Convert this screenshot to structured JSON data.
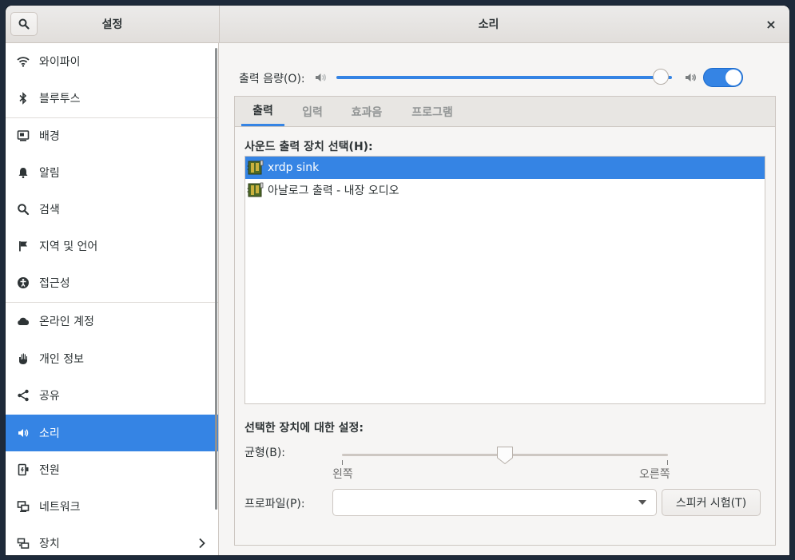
{
  "header": {
    "sidebar_title": "설정",
    "main_title": "소리",
    "close_glyph": "×"
  },
  "sidebar": {
    "items": [
      {
        "label": "와이파이",
        "icon": "wifi-icon"
      },
      {
        "label": "블루투스",
        "icon": "bluetooth-icon"
      },
      {
        "label": "배경",
        "icon": "background-icon"
      },
      {
        "label": "알림",
        "icon": "bell-icon"
      },
      {
        "label": "검색",
        "icon": "search-icon"
      },
      {
        "label": "지역 및 언어",
        "icon": "flag-icon"
      },
      {
        "label": "접근성",
        "icon": "accessibility-icon"
      },
      {
        "label": "온라인 계정",
        "icon": "cloud-icon"
      },
      {
        "label": "개인 정보",
        "icon": "hand-icon"
      },
      {
        "label": "공유",
        "icon": "share-icon"
      },
      {
        "label": "소리",
        "icon": "speaker-icon"
      },
      {
        "label": "전원",
        "icon": "power-icon"
      },
      {
        "label": "네트워크",
        "icon": "network-icon"
      },
      {
        "label": "장치",
        "icon": "devices-icon"
      }
    ],
    "active": "소리"
  },
  "volume": {
    "label": "출력 음량(O):",
    "level": 0.99,
    "enabled": true
  },
  "tabs": [
    "출력",
    "입력",
    "효과음",
    "프로그램"
  ],
  "active_tab": "출력",
  "output": {
    "device_section_label": "사운드 출력 장치 선택(H):",
    "devices": [
      "xrdp sink",
      "아날로그 출력 - 내장 오디오"
    ],
    "selected_device": "xrdp sink",
    "settings_label": "선택한 장치에 대한 설정:",
    "balance_label": "균형(B):",
    "balance_left": "왼쪽",
    "balance_right": "오른쪽",
    "balance_value": 0.5,
    "profile_label": "프로파일(P):",
    "profile_value": "",
    "test_button": "스피커 시험(T)"
  },
  "colors": {
    "accent": "#3584e4"
  }
}
